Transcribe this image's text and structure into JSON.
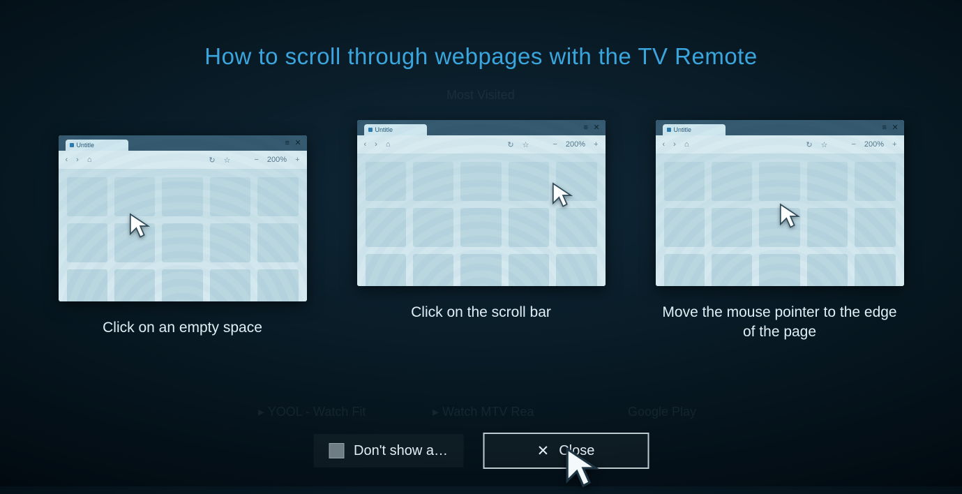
{
  "title": "How to scroll through webpages with the TV Remote",
  "browser_tab": "Untitle",
  "browser_zoom": "200%",
  "cards": [
    {
      "caption": "Click on an empty space"
    },
    {
      "caption": "Click on the scroll bar"
    },
    {
      "caption": "Move the mouse pointer to the edge of the page"
    }
  ],
  "buttons": {
    "dont_show": "Don't show a…",
    "close": "Close"
  }
}
